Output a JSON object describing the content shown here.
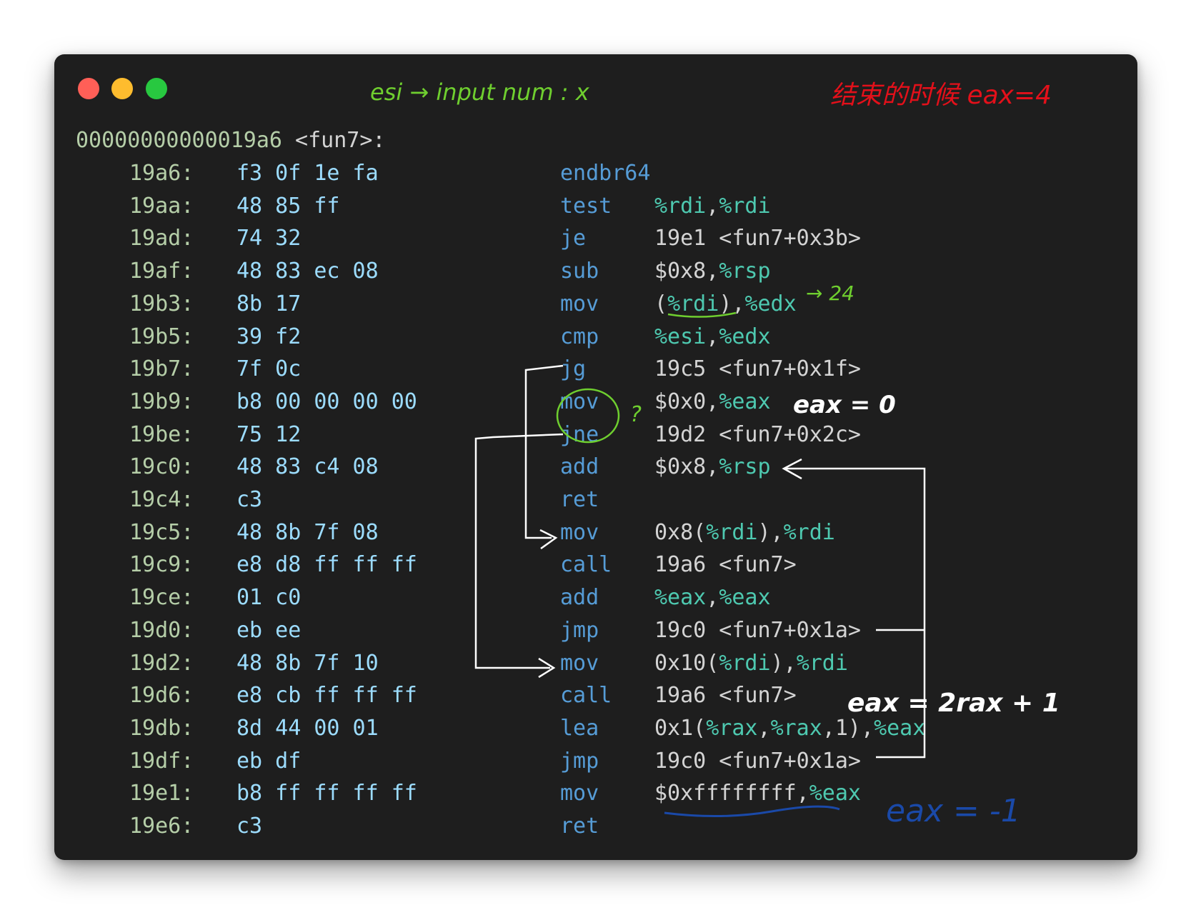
{
  "function_header": {
    "address": "00000000000019a6",
    "symbol": " <fun7>:"
  },
  "instructions": [
    {
      "addr": "19a6:",
      "bytes": "f3 0f 1e fa",
      "mnemonic": "endbr64",
      "operands": ""
    },
    {
      "addr": "19aa:",
      "bytes": "48 85 ff",
      "mnemonic": "test",
      "operands": "%rdi,%rdi"
    },
    {
      "addr": "19ad:",
      "bytes": "74 32",
      "mnemonic": "je",
      "operands": "19e1 <fun7+0x3b>"
    },
    {
      "addr": "19af:",
      "bytes": "48 83 ec 08",
      "mnemonic": "sub",
      "operands": "$0x8,%rsp"
    },
    {
      "addr": "19b3:",
      "bytes": "8b 17",
      "mnemonic": "mov",
      "operands": "(%rdi),%edx"
    },
    {
      "addr": "19b5:",
      "bytes": "39 f2",
      "mnemonic": "cmp",
      "operands": "%esi,%edx"
    },
    {
      "addr": "19b7:",
      "bytes": "7f 0c",
      "mnemonic": "jg",
      "operands": "19c5 <fun7+0x1f>"
    },
    {
      "addr": "19b9:",
      "bytes": "b8 00 00 00 00",
      "mnemonic": "mov",
      "operands": "$0x0,%eax"
    },
    {
      "addr": "19be:",
      "bytes": "75 12",
      "mnemonic": "jne",
      "operands": "19d2 <fun7+0x2c>"
    },
    {
      "addr": "19c0:",
      "bytes": "48 83 c4 08",
      "mnemonic": "add",
      "operands": "$0x8,%rsp"
    },
    {
      "addr": "19c4:",
      "bytes": "c3",
      "mnemonic": "ret",
      "operands": ""
    },
    {
      "addr": "19c5:",
      "bytes": "48 8b 7f 08",
      "mnemonic": "mov",
      "operands": "0x8(%rdi),%rdi"
    },
    {
      "addr": "19c9:",
      "bytes": "e8 d8 ff ff ff",
      "mnemonic": "call",
      "operands": "19a6 <fun7>"
    },
    {
      "addr": "19ce:",
      "bytes": "01 c0",
      "mnemonic": "add",
      "operands": "%eax,%eax"
    },
    {
      "addr": "19d0:",
      "bytes": "eb ee",
      "mnemonic": "jmp",
      "operands": "19c0 <fun7+0x1a>"
    },
    {
      "addr": "19d2:",
      "bytes": "48 8b 7f 10",
      "mnemonic": "mov",
      "operands": "0x10(%rdi),%rdi"
    },
    {
      "addr": "19d6:",
      "bytes": "e8 cb ff ff ff",
      "mnemonic": "call",
      "operands": "19a6 <fun7>"
    },
    {
      "addr": "19db:",
      "bytes": "8d 44 00 01",
      "mnemonic": "lea",
      "operands": "0x1(%rax,%rax,1),%eax"
    },
    {
      "addr": "19df:",
      "bytes": "eb df",
      "mnemonic": "jmp",
      "operands": "19c0 <fun7+0x1a>"
    },
    {
      "addr": "19e1:",
      "bytes": "b8 ff ff ff ff",
      "mnemonic": "mov",
      "operands": "$0xffffffff,%eax"
    },
    {
      "addr": "19e6:",
      "bytes": "c3",
      "mnemonic": "ret",
      "operands": ""
    }
  ],
  "annotations": {
    "esi_note": "esi → input num : x",
    "end_note": "结束的时候 eax=4",
    "edx_value": "→ 24",
    "eax_zero": "eax = 0",
    "eax_2rax": "eax = 2rax + 1",
    "eax_minus1": "eax = -1",
    "question_mark": "?"
  },
  "colors": {
    "window_bg": "#1e1e1e",
    "address": "#b5cea8",
    "bytes": "#9cdcfe",
    "mnemonic": "#569cd6",
    "operand_text": "#d4d4d4",
    "register": "#4ec9b0",
    "annot_green": "#6fcf2f",
    "annot_red": "#e3101a",
    "annot_blue": "#1a49a8",
    "annot_white": "#ffffff"
  }
}
